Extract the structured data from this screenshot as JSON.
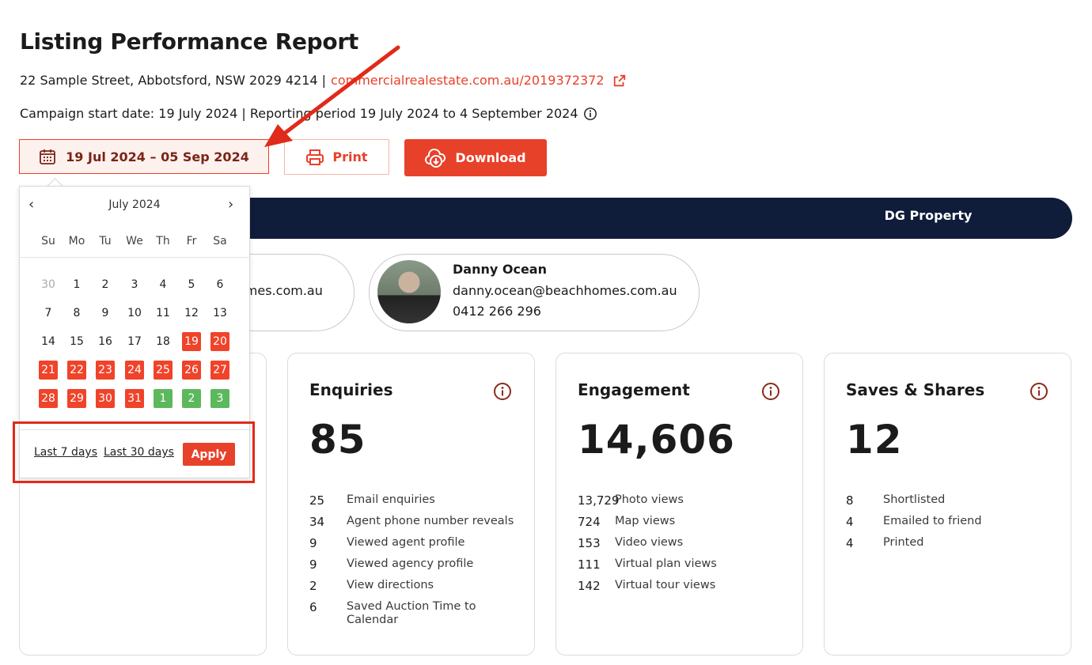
{
  "report": {
    "title": "Listing Performance Report",
    "address": "22 Sample Street, Abbotsford, NSW 2029 4214 |",
    "listing_link": "commercialrealestate.com.au/2019372372",
    "campaign_text": "Campaign start date: 19 July 2024 | Reporting period 19 July 2024 to 4 September 2024"
  },
  "toolbar": {
    "date_range": "19 Jul 2024 – 05 Sep 2024",
    "print_label": "Print",
    "download_label": "Download"
  },
  "agency": {
    "name": "DG Property"
  },
  "agents": [
    {
      "email_partial": "omes.com.au"
    },
    {
      "name": "Danny Ocean",
      "email": "danny.ocean@beachhomes.com.au",
      "phone": "0412 266 296"
    }
  ],
  "calendar": {
    "month": "July 2024",
    "weekdays": [
      "Su",
      "Mo",
      "Tu",
      "We",
      "Th",
      "Fr",
      "Sa"
    ],
    "weeks": [
      [
        {
          "d": "30",
          "s": "muted"
        },
        {
          "d": "1"
        },
        {
          "d": "2"
        },
        {
          "d": "3"
        },
        {
          "d": "4"
        },
        {
          "d": "5"
        },
        {
          "d": "6"
        }
      ],
      [
        {
          "d": "7"
        },
        {
          "d": "8"
        },
        {
          "d": "9"
        },
        {
          "d": "10"
        },
        {
          "d": "11"
        },
        {
          "d": "12"
        },
        {
          "d": "13"
        }
      ],
      [
        {
          "d": "14"
        },
        {
          "d": "15"
        },
        {
          "d": "16"
        },
        {
          "d": "17"
        },
        {
          "d": "18"
        },
        {
          "d": "19",
          "s": "sel"
        },
        {
          "d": "20",
          "s": "sel"
        }
      ],
      [
        {
          "d": "21",
          "s": "sel"
        },
        {
          "d": "22",
          "s": "sel"
        },
        {
          "d": "23",
          "s": "sel"
        },
        {
          "d": "24",
          "s": "sel"
        },
        {
          "d": "25",
          "s": "sel"
        },
        {
          "d": "26",
          "s": "sel"
        },
        {
          "d": "27",
          "s": "sel"
        }
      ],
      [
        {
          "d": "28",
          "s": "sel"
        },
        {
          "d": "29",
          "s": "sel"
        },
        {
          "d": "30",
          "s": "sel"
        },
        {
          "d": "31",
          "s": "sel"
        },
        {
          "d": "1",
          "s": "green"
        },
        {
          "d": "2",
          "s": "green"
        },
        {
          "d": "3",
          "s": "green"
        }
      ]
    ],
    "last7": "Last 7 days",
    "last30": "Last 30 days",
    "apply": "Apply"
  },
  "cards": {
    "enquiries": {
      "title": "Enquiries",
      "total": "85",
      "rows": [
        {
          "v": "25",
          "l": "Email enquiries"
        },
        {
          "v": "34",
          "l": "Agent phone number reveals"
        },
        {
          "v": "9",
          "l": "Viewed agent profile"
        },
        {
          "v": "9",
          "l": "Viewed agency profile"
        },
        {
          "v": "2",
          "l": "View directions"
        },
        {
          "v": "6",
          "l": "Saved Auction Time to Calendar"
        }
      ]
    },
    "engagement": {
      "title": "Engagement",
      "total": "14,606",
      "rows": [
        {
          "v": "13,729",
          "l": "Photo views"
        },
        {
          "v": "724",
          "l": "Map views"
        },
        {
          "v": "153",
          "l": "Video views"
        },
        {
          "v": "111",
          "l": "Virtual plan views"
        },
        {
          "v": "142",
          "l": "Virtual tour views"
        }
      ]
    },
    "saves": {
      "title": "Saves & Shares",
      "total": "12",
      "rows": [
        {
          "v": "8",
          "l": "Shortlisted"
        },
        {
          "v": "4",
          "l": "Emailed to friend"
        },
        {
          "v": "4",
          "l": "Printed"
        }
      ]
    }
  },
  "colors": {
    "accent": "#e8412a",
    "navy": "#0f1c3a",
    "green": "#5cb85c"
  }
}
